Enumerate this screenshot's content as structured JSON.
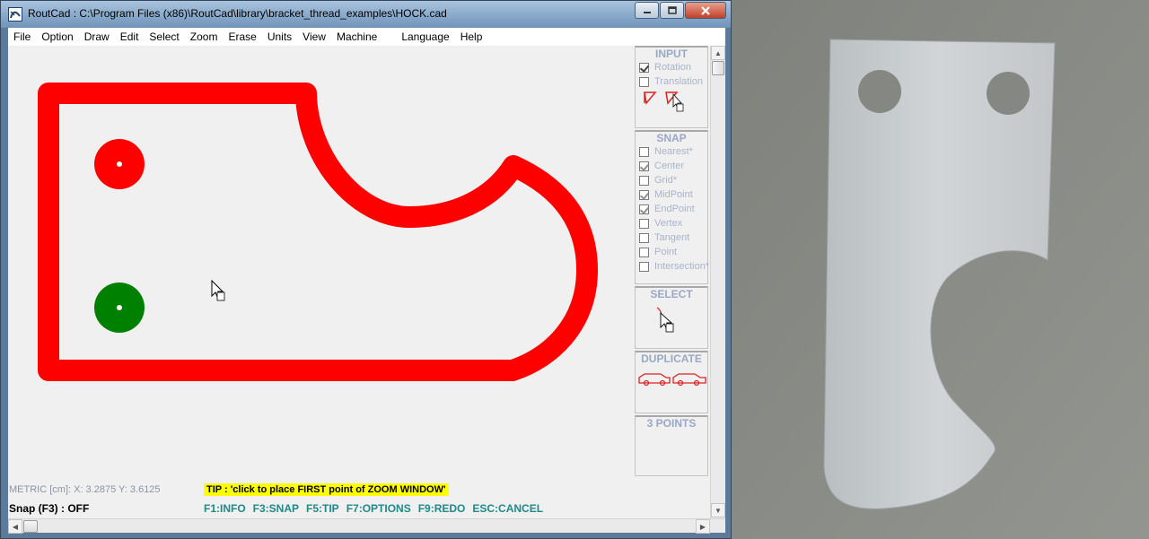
{
  "window": {
    "title": "RoutCad : C:\\Program Files (x86)\\RoutCad\\library\\bracket_thread_examples\\HOCK.cad",
    "app_icon": "routcad-logo-icon",
    "buttons": [
      "minimize-icon",
      "maximize-icon",
      "close-icon"
    ]
  },
  "menu": [
    "File",
    "Option",
    "Draw",
    "Edit",
    "Select",
    "Zoom",
    "Erase",
    "Units",
    "View",
    "Machine",
    "Language",
    "Help"
  ],
  "canvas": {
    "shape_color": "#ff0000",
    "hole_colors": [
      "#ff0000",
      "#008000"
    ],
    "cursor_icon": "arrow-cursor-icon"
  },
  "panel": {
    "input": {
      "title": "INPUT",
      "rotation": "Rotation",
      "rotation_checked": true,
      "translation": "Translation",
      "translation_checked": false,
      "icons": [
        "rotate-shape-icon",
        "rotate-shape-cursor-icon"
      ]
    },
    "snap": {
      "title": "SNAP",
      "options": [
        {
          "label": "Nearest*",
          "checked": false
        },
        {
          "label": "Center",
          "checked": true
        },
        {
          "label": "Grid*",
          "checked": false
        },
        {
          "label": "MidPoint",
          "checked": true
        },
        {
          "label": "EndPoint",
          "checked": true
        },
        {
          "label": "Vertex",
          "checked": false
        },
        {
          "label": "Tangent",
          "checked": false
        },
        {
          "label": "Point",
          "checked": false
        },
        {
          "label": "Intersection*",
          "checked": false
        }
      ]
    },
    "select": {
      "title": "SELECT",
      "icon": "select-cursor-icon"
    },
    "duplicate": {
      "title": "DUPLICATE",
      "icon": "duplicate-cars-icon"
    },
    "three_points": {
      "title": "3 POINTS"
    }
  },
  "status": {
    "coords": "METRIC [cm]: X: 3.2875  Y: 3.6125",
    "tip": "TIP : 'click to place FIRST point of ZOOM WINDOW'",
    "snap": "Snap (F3) : OFF",
    "hotkeys": [
      "F1:INFO",
      "F3:SNAP",
      "F5:TIP",
      "F7:OPTIONS",
      "F9:REDO",
      "ESC:CANCEL"
    ]
  },
  "photo": {
    "subject": "aluminium-bracket-photo",
    "background": "#8a8c87",
    "metal": "#c6cacc"
  }
}
